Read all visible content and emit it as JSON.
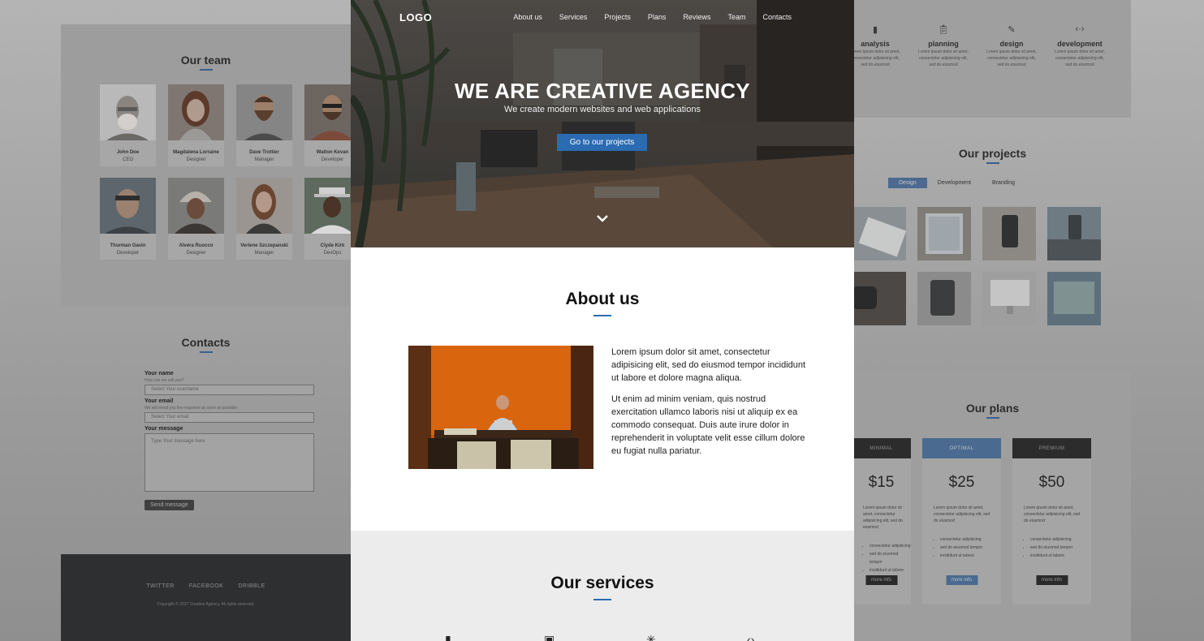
{
  "nav": {
    "logo": "LOGO",
    "links": [
      "About us",
      "Services",
      "Projects",
      "Plans",
      "Reviews",
      "Team",
      "Contacts"
    ]
  },
  "hero": {
    "title_light": "WE ARE ",
    "title_bold": "CREATIVE AGENCY",
    "subtitle": "We create modern websites and web applications",
    "cta": "Go to our projects",
    "scroll_icon": "chevron-down-icon"
  },
  "about": {
    "title": "About us",
    "paragraphs": [
      "Lorem ipsum dolor sit amet, consectetur adipisicing elit, sed do eiusmod tempor incididunt ut labore et dolore magna aliqua.",
      "Ut enim ad minim veniam, quis nostrud exercitation ullamco laboris nisi ut aliquip ex ea commodo consequat. Duis aute irure dolor in reprehenderit in voluptate velit esse cillum dolore eu fugiat nulla pariatur."
    ]
  },
  "services": {
    "title": "Our services"
  },
  "team": {
    "title": "Our team",
    "members": [
      {
        "name": "John Doe",
        "role": "CEO"
      },
      {
        "name": "Magdalena Lorraine",
        "role": "Designer"
      },
      {
        "name": "Dave Trottier",
        "role": "Manager"
      },
      {
        "name": "Walton Kevan",
        "role": "Developer"
      },
      {
        "name": "Thurman Gavin",
        "role": "Developer"
      },
      {
        "name": "Alvera Ruocco",
        "role": "Designer"
      },
      {
        "name": "Verlene Szczepanski",
        "role": "Manager"
      },
      {
        "name": "Clyde Kirk",
        "role": "DevOps"
      }
    ]
  },
  "contacts": {
    "title": "Contacts",
    "name_label": "Your name",
    "name_hint": "How can we call you?",
    "name_placeholder": "Select Your username",
    "email_label": "Your email",
    "email_hint": "We will email you the response as soon as possible",
    "email_placeholder": "Select Your email",
    "message_label": "Your message",
    "message_placeholder": "Type Your message here",
    "send": "Send message"
  },
  "footer": {
    "links": [
      "TWITTER",
      "FACEBOOK",
      "DRIBBLE"
    ],
    "copyright": "Copyright © 2017 Creative Agency. All rights reserved."
  },
  "right_services": [
    {
      "title": "analysis",
      "desc": "Lorem ipsum dolor sit amet, consectetur adipisicing elit, sed do eiusmod",
      "icon": "bar-chart-icon"
    },
    {
      "title": "planning",
      "desc": "Lorem ipsum dolor sit amet, consectetur adipisicing elit, sed do eiusmod",
      "icon": "clipboard-icon"
    },
    {
      "title": "design",
      "desc": "Lorem ipsum dolor sit amet, consectetur adipisicing elit, sed do eiusmod",
      "icon": "magic-wand-icon"
    },
    {
      "title": "development",
      "desc": "Lorem ipsum dolor sit amet, consectetur adipisicing elit, sed do eiusmod",
      "icon": "code-icon"
    }
  ],
  "projects": {
    "title": "Our projects",
    "tabs": [
      "Design",
      "Development",
      "Branding"
    ],
    "active_tab": "Design"
  },
  "plans": {
    "title": "Our plans",
    "items": [
      {
        "name": "MINIMAL",
        "price": "$15",
        "desc": "Lorem ipsum dolor sit amet, consectetur adipisicing elit, sed do eiusmod",
        "features": [
          "consectetur adipisicing",
          "sed do eiusmod tempor",
          "incididunt ut labore"
        ],
        "button": "more info"
      },
      {
        "name": "OPTIMAL",
        "price": "$25",
        "desc": "Lorem ipsum dolor sit amet, consectetur adipisicing elit, sed do eiusmod",
        "features": [
          "consectetur adipisicing",
          "sed do eiusmod tempor",
          "incididunt ut labore"
        ],
        "button": "more info"
      },
      {
        "name": "PREMIUM",
        "price": "$50",
        "desc": "Lorem ipsum dolor sit amet, consectetur adipisicing elit, sed do eiusmod",
        "features": [
          "consectetur adipisicing",
          "sed do eiusmod tempor",
          "incididunt ut labore"
        ],
        "button": "more info"
      }
    ]
  },
  "colors": {
    "accent": "#2a6bb1",
    "dim_overlay": "#9d9d9d",
    "footer": "#2e2f31"
  }
}
